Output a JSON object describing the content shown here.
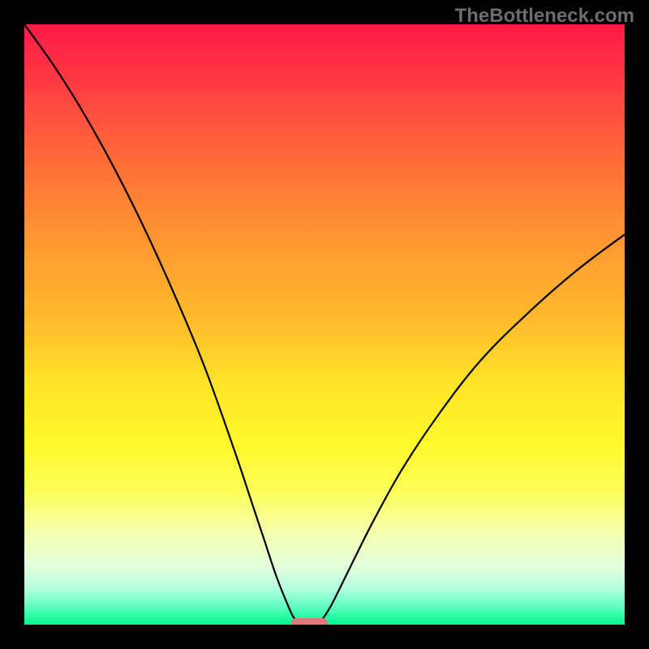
{
  "watermark": "TheBottleneck.com",
  "chart_data": {
    "type": "line",
    "title": "",
    "xlabel": "",
    "ylabel": "",
    "xlim": [
      0,
      100
    ],
    "ylim": [
      0,
      100
    ],
    "series": [
      {
        "name": "left-curve",
        "x": [
          0,
          5,
          10,
          15,
          20,
          25,
          30,
          35,
          38,
          40,
          42,
          44,
          45,
          46
        ],
        "values": [
          100,
          93,
          85,
          76,
          66,
          55,
          43,
          29,
          20,
          14,
          8,
          3,
          1,
          0
        ]
      },
      {
        "name": "right-curve",
        "x": [
          49,
          51,
          54,
          58,
          63,
          69,
          76,
          84,
          92,
          100
        ],
        "values": [
          0,
          3,
          9,
          17,
          26,
          35,
          44,
          52,
          59,
          65
        ]
      }
    ],
    "marker": {
      "x_center": 47.5,
      "x_width": 6,
      "y": 0
    },
    "gradient_stops": [
      {
        "pos": 0,
        "color": "#ff1a47"
      },
      {
        "pos": 50,
        "color": "#ffbe2e"
      },
      {
        "pos": 70,
        "color": "#fff82a"
      },
      {
        "pos": 100,
        "color": "#00f58f"
      }
    ]
  },
  "layout": {
    "plot_size": 740,
    "marker_height": 12
  }
}
